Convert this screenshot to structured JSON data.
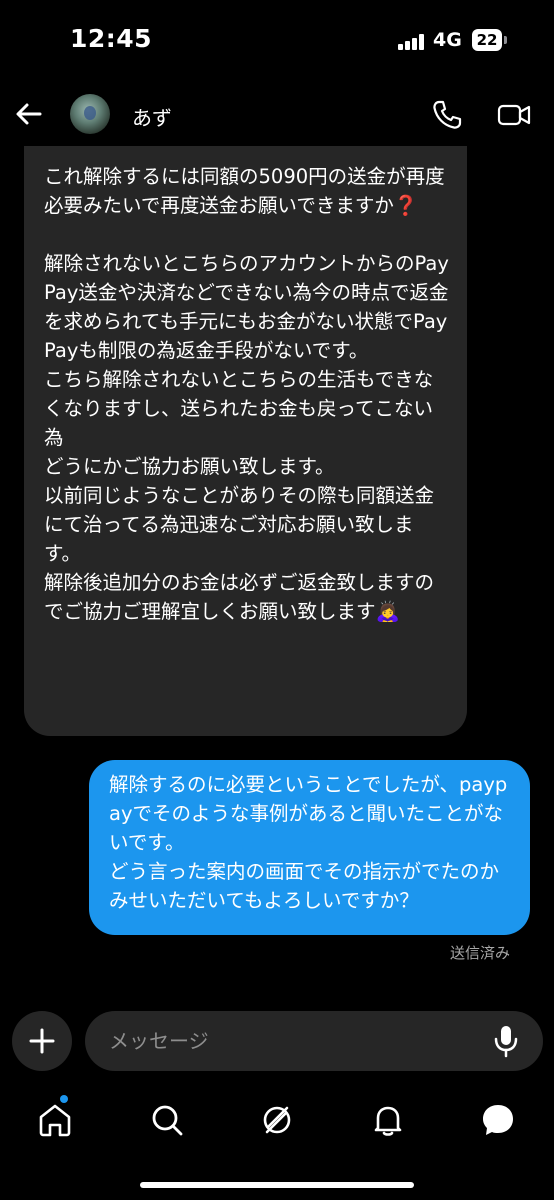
{
  "status_bar": {
    "time": "12:45",
    "network": "4G",
    "battery": "22"
  },
  "header": {
    "contact_name": "あず",
    "icons": [
      "back-arrow-icon",
      "avatar",
      "phone-icon",
      "video-icon"
    ]
  },
  "messages": [
    {
      "direction": "incoming",
      "text": "これ解除するには同額の5090円の送金が再度必要みたいで再度送金お願いできますか❓\n\n解除されないとこちらのアカウントからのPayPay送金や決済などできない為今の時点で返金を求められても手元にもお金がない状態でPayPayも制限の為返金手段がないです。\nこちら解除されないとこちらの生活もできなくなりますし、送られたお金も戻ってこない為\nどうにかご協力お願い致します。\n以前同じようなことがありその際も同額送金にて治ってる為迅速なご対応お願い致します。\n解除後追加分のお金は必ずご返金致しますのでご協力ご理解宜しくお願い致します🙇‍♀️"
    },
    {
      "direction": "outgoing",
      "text": "解除するのに必要ということでしたが、paypayでそのような事例があると聞いたことがないです。\nどう言った案内の画面でその指示がでたのかみせいただいてもよろしいですか？",
      "status": "送信済み"
    }
  ],
  "composer": {
    "placeholder": "メッセージ",
    "icons": [
      "plus-icon",
      "mic-icon"
    ]
  },
  "tab_bar": {
    "tabs": [
      "home-icon",
      "search-icon",
      "reels-icon",
      "notifications-icon",
      "messages-icon"
    ]
  },
  "colors": {
    "background": "#000000",
    "incoming_bubble": "#262626",
    "outgoing_bubble": "#1c96ee",
    "accent": "#1c96ee"
  }
}
